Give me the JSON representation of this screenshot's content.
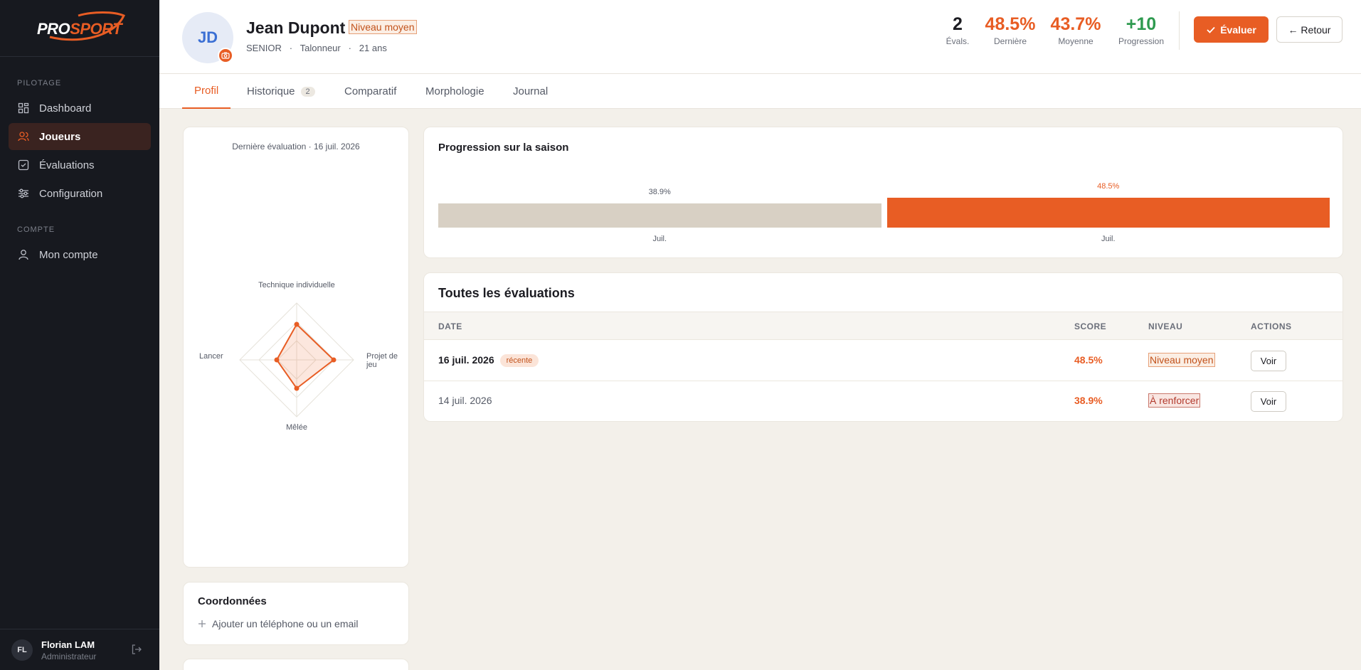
{
  "brand": {
    "logo_pro": "PRO",
    "logo_sport": "SPORT",
    "accent": "#e85d24",
    "sidebar_bg": "#17191f"
  },
  "sidebar": {
    "sections": [
      {
        "label": "PILOTAGE"
      },
      {
        "label": "COMPTE"
      }
    ],
    "items": [
      {
        "label": "Dashboard",
        "icon": "dashboard-icon",
        "active": false
      },
      {
        "label": "Joueurs",
        "icon": "users-icon",
        "active": true
      },
      {
        "label": "Évaluations",
        "icon": "checklist-icon",
        "active": false
      },
      {
        "label": "Configuration",
        "icon": "sliders-icon",
        "active": false
      },
      {
        "label": "Mon compte",
        "icon": "user-icon",
        "active": false
      }
    ],
    "user": {
      "initials": "FL",
      "name": "Florian LAM",
      "role": "Administrateur"
    }
  },
  "player": {
    "initials": "JD",
    "name": "Jean Dupont",
    "level": "Niveau moyen",
    "category": "SENIOR",
    "position": "Talonneur",
    "age": "21 ans",
    "sep": "·"
  },
  "stats": [
    {
      "value": "2",
      "label": "Évals.",
      "color": "#1c1c22"
    },
    {
      "value": "48.5%",
      "label": "Dernière",
      "color": "#e85d24"
    },
    {
      "value": "43.7%",
      "label": "Moyenne",
      "color": "#e85d24"
    },
    {
      "value": "+10",
      "label": "Progression",
      "color": "#2e9a4f"
    }
  ],
  "actions": {
    "evaluate": "Évaluer",
    "back": "← Retour"
  },
  "tabs": [
    {
      "label": "Profil",
      "active": true
    },
    {
      "label": "Historique",
      "count": "2"
    },
    {
      "label": "Comparatif"
    },
    {
      "label": "Morphologie"
    },
    {
      "label": "Journal"
    }
  ],
  "radar": {
    "title": "Dernière évaluation · 16 juil. 2026",
    "axes": [
      "Technique individuelle",
      "Projet de jeu",
      "Mêlée",
      "Lancer"
    ]
  },
  "coordinates": {
    "title": "Coordonnées",
    "add": "Ajouter un téléphone ou un email"
  },
  "chart_data": {
    "type": "bar",
    "title": "Progression sur la saison",
    "categories": [
      "Juil.",
      "Juil."
    ],
    "values": [
      38.9,
      48.5
    ],
    "value_labels": [
      "38.9%",
      "48.5%"
    ],
    "colors": [
      "#d8d0c4",
      "#e85d24"
    ],
    "ylim": [
      0,
      100
    ]
  },
  "evaluations": {
    "title": "Toutes les évaluations",
    "columns": [
      "DATE",
      "SCORE",
      "NIVEAU",
      "ACTIONS"
    ],
    "rows": [
      {
        "date": "16 juil. 2026",
        "badge": "récente",
        "score": "48.5%",
        "level": "Niveau moyen",
        "action": "Voir"
      },
      {
        "date": "14 juil. 2026",
        "score": "38.9%",
        "level": "À renforcer",
        "action": "Voir"
      }
    ]
  }
}
